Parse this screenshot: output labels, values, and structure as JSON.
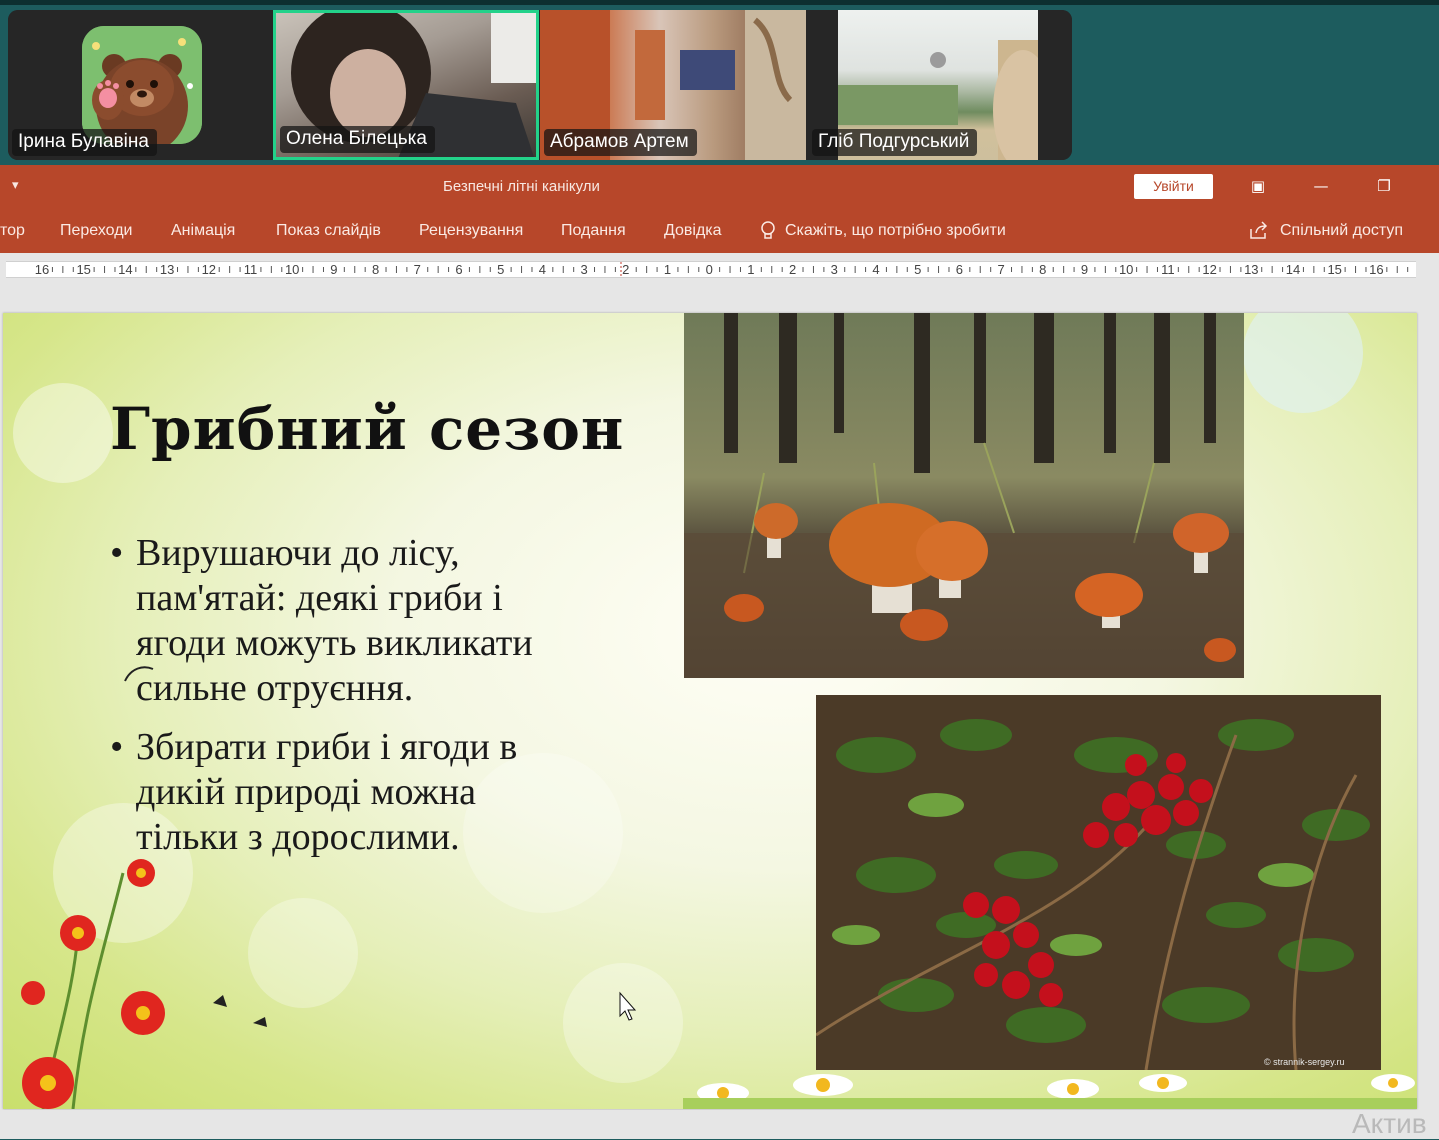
{
  "participants": [
    {
      "name": "Ірина Булавіна"
    },
    {
      "name": "Олена Білецька"
    },
    {
      "name": "Абрамов Артем"
    },
    {
      "name": "Гліб Подгурський"
    }
  ],
  "powerpoint": {
    "title": "Безпечні літні канікули",
    "signin_label": "Увійти",
    "quick_access_glyph": "▾",
    "window_buttons": {
      "restore_layout": "▣",
      "minimize": "—",
      "maximize": "❐"
    },
    "ribbon": {
      "tabs": [
        "тор",
        "Переходи",
        "Анімація",
        "Показ слайдів",
        "Рецензування",
        "Подання",
        "Довідка"
      ],
      "tell_me": "Скажіть, що потрібно зробити",
      "share": "Спільний доступ"
    },
    "ruler_labels": [
      "16",
      "15",
      "14",
      "13",
      "12",
      "11",
      "10",
      "9",
      "8",
      "7",
      "6",
      "5",
      "4",
      "3",
      "2",
      "1",
      "0",
      "1",
      "2",
      "3",
      "4",
      "5",
      "6",
      "7",
      "8",
      "9",
      "10",
      "11",
      "12",
      "13",
      "14",
      "15",
      "16"
    ]
  },
  "slide": {
    "title": "Грибний сезон",
    "bullets": [
      {
        "lines": [
          "Вирушаючи до лісу,",
          "пам'ятай: деякі гриби і",
          "ягоди можуть викликати",
          "сильне отруєння."
        ]
      },
      {
        "lines": [
          "Збирати гриби і ягоди в",
          "дикій природі можна",
          "тільки з дорослими."
        ]
      }
    ],
    "bullet_glyph": "•",
    "photo_credit": "© strannik-sergey.ru"
  },
  "watermark": "Актив",
  "colors": {
    "ppt_accent": "#b7472a",
    "strip_bg": "#1d5c5e",
    "active_speaker_border": "#23d28a"
  }
}
